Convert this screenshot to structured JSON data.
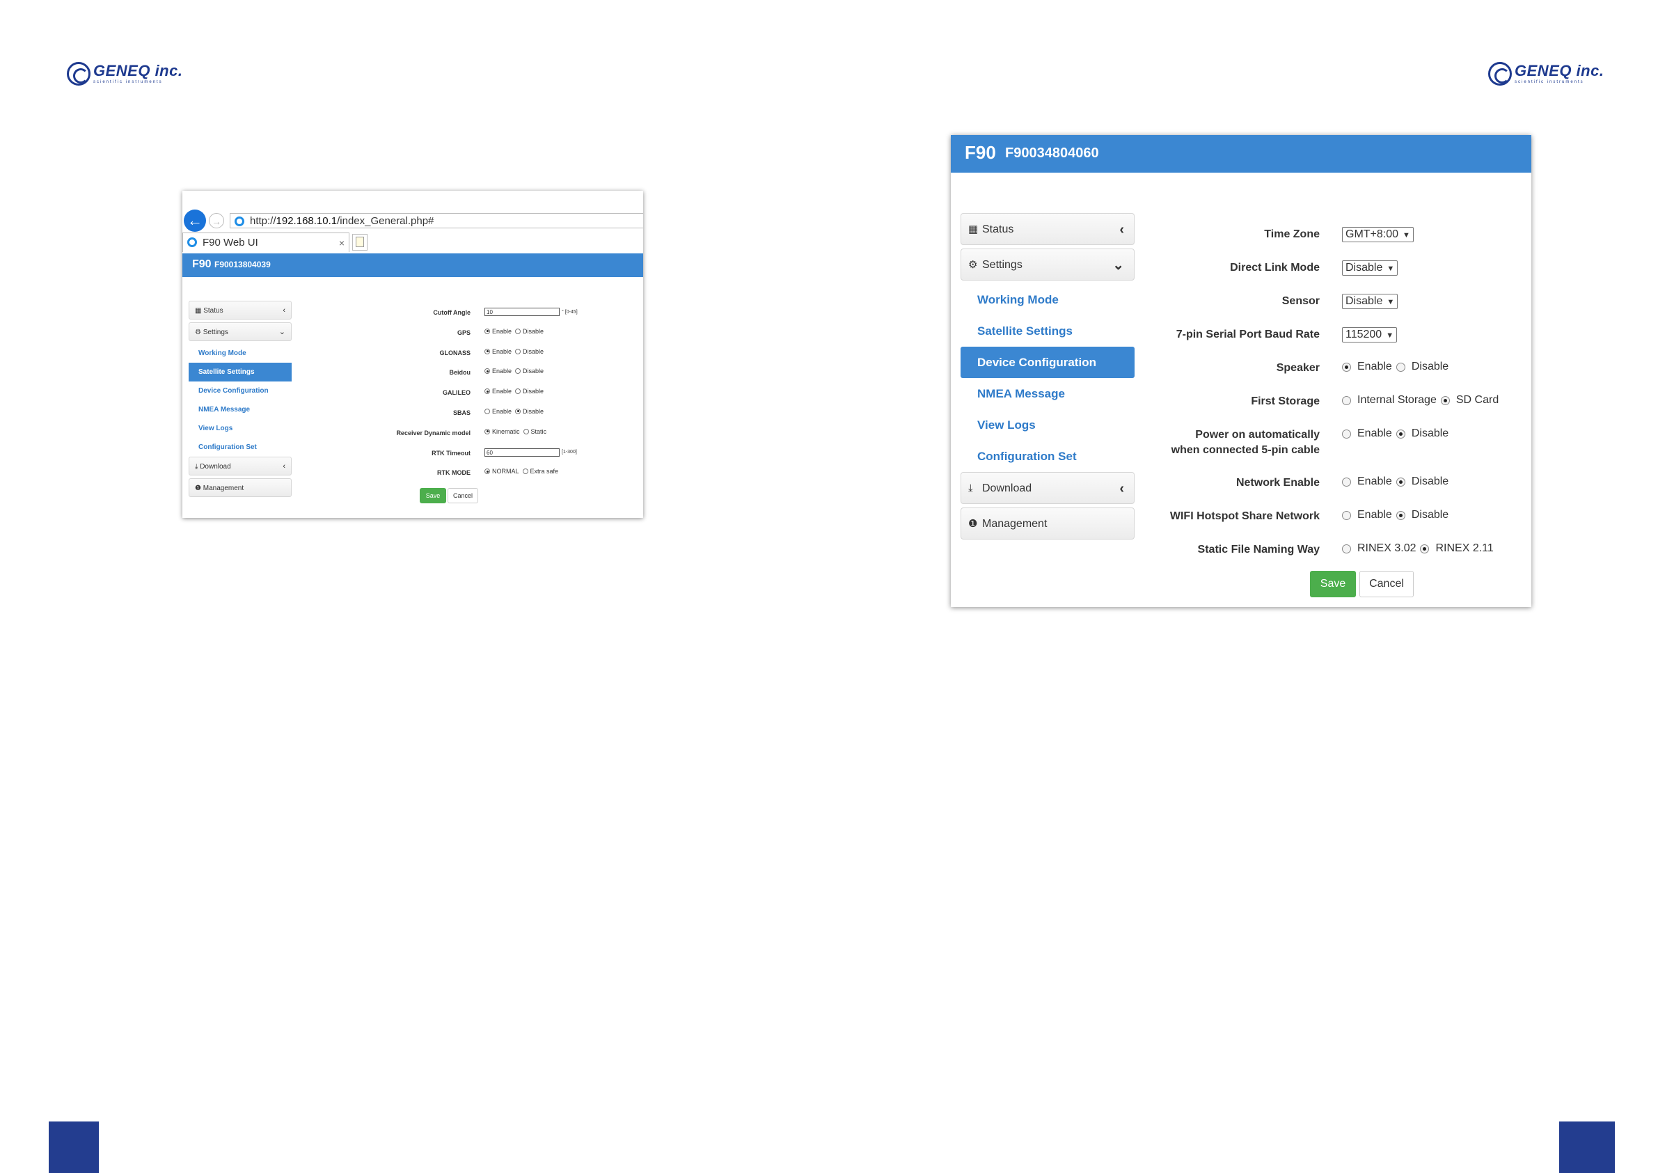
{
  "logo": {
    "name": "GENEQ inc.",
    "tagline": "scientific instruments"
  },
  "small_shot": {
    "url_prefix": "http://",
    "url_host": "192.168.10.1",
    "url_path": "/index_General.php#",
    "tab_title": "F90 Web UI",
    "tab_close": "×",
    "model": "F90",
    "serial": "F90013804039",
    "sidebar": {
      "status": "Status",
      "settings": "Settings",
      "links": [
        "Working Mode",
        "Satellite Settings",
        "Device Configuration",
        "NMEA Message",
        "View Logs",
        "Configuration Set"
      ],
      "download": "Download",
      "management": "Management"
    },
    "form": {
      "cutoff_label": "Cutoff Angle",
      "cutoff_value": "10",
      "cutoff_hint": "° [0-45]",
      "gps_label": "GPS",
      "glonass_label": "GLONASS",
      "beidou_label": "Beidou",
      "galileo_label": "GALILEO",
      "sbas_label": "SBAS",
      "dyn_label": "Receiver Dynamic model",
      "dyn_opt1": "Kinematic",
      "dyn_opt2": "Static",
      "rtk_timeout_label": "RTK Timeout",
      "rtk_timeout_value": "60",
      "rtk_timeout_hint": "[1-300]",
      "rtk_mode_label": "RTK MODE",
      "rtk_mode_opt1": "NORMAL",
      "rtk_mode_opt2": "Extra safe",
      "enable": "Enable",
      "disable": "Disable",
      "save": "Save",
      "cancel": "Cancel"
    }
  },
  "big_shot": {
    "model": "F90",
    "serial": "F90034804060",
    "sidebar": {
      "status": "Status",
      "settings": "Settings",
      "links": [
        "Working Mode",
        "Satellite Settings",
        "Device Configuration",
        "NMEA Message",
        "View Logs",
        "Configuration Set"
      ],
      "download": "Download",
      "management": "Management"
    },
    "form": {
      "time_zone_label": "Time Zone",
      "time_zone_value": "GMT+8:00",
      "direct_link_label": "Direct Link Mode",
      "direct_link_value": "Disable",
      "sensor_label": "Sensor",
      "sensor_value": "Disable",
      "baud_label": "7-pin Serial Port Baud Rate",
      "baud_value": "115200",
      "speaker_label": "Speaker",
      "first_storage_label": "First Storage",
      "storage_opt1": "Internal Storage",
      "storage_opt2": "SD Card",
      "power_label_1": "Power on automatically",
      "power_label_2": "when connected 5-pin cable",
      "network_label": "Network Enable",
      "wifi_label": "WIFI Hotspot Share Network",
      "naming_label": "Static File Naming Way",
      "naming_opt1": "RINEX 3.02",
      "naming_opt2": "RINEX 2.11",
      "enable": "Enable",
      "disable": "Disable",
      "save": "Save",
      "cancel": "Cancel"
    }
  },
  "colors": {
    "header": "#3b87d2",
    "link": "#2f7bc9",
    "save": "#4cae4c",
    "brand": "#1e3a8f",
    "page_tab": "#233d8f"
  }
}
